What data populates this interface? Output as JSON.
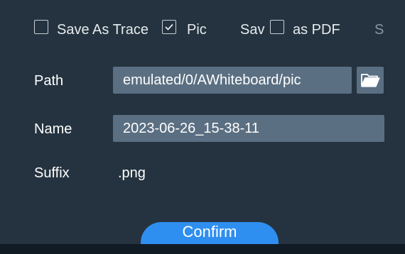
{
  "options": {
    "save_as_trace": {
      "label": "Save As Trace",
      "checked": false
    },
    "pic": {
      "label": "Pic",
      "checked": true
    },
    "save_as_pdf": {
      "label_left": "Sav",
      "label_right": "as PDF",
      "checked": false
    },
    "partial_label": "S"
  },
  "form": {
    "path": {
      "label": "Path",
      "value": "emulated/0/AWhiteboard/pic"
    },
    "name": {
      "label": "Name",
      "value": "2023-06-26_15-38-11"
    },
    "suffix": {
      "label": "Suffix",
      "value": ".png"
    }
  },
  "icons": {
    "folder": "folder-open-icon",
    "check": "checkmark-icon"
  },
  "colors": {
    "background": "#24333f",
    "field": "#5b6f82",
    "accent": "#2f8ff0",
    "text": "#ffffff"
  },
  "confirm_label": "Confirm"
}
